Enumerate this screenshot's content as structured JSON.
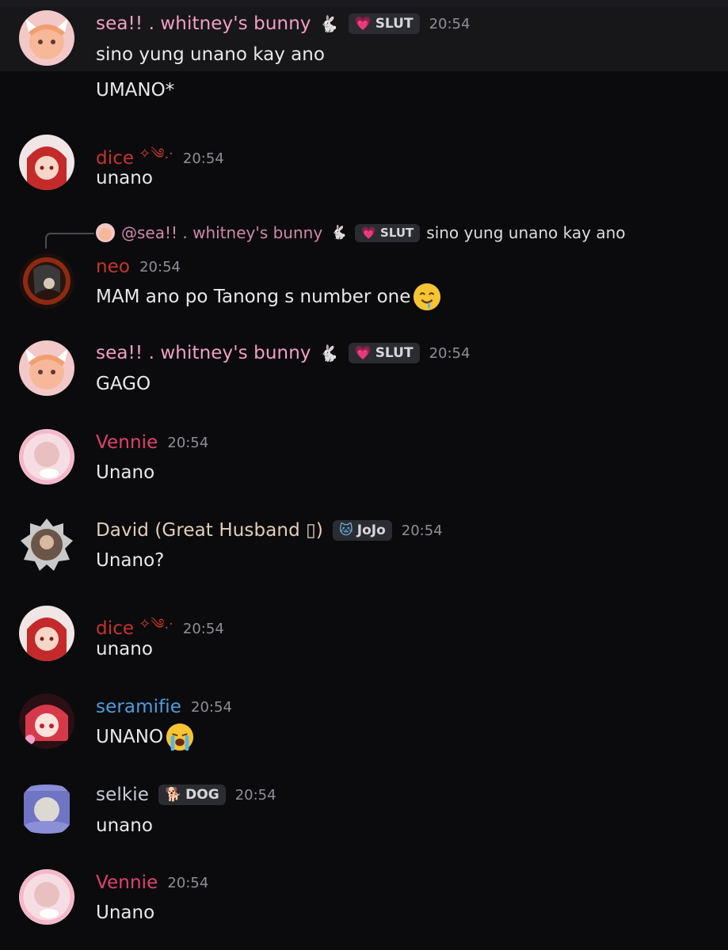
{
  "colors": {
    "background": "#0b0b0d",
    "highlight_row": "#17171a",
    "username_sea": "#f39fc4",
    "username_dice": "#c7342a",
    "username_neo": "#c7342a",
    "username_vennie": "#e0426f",
    "username_david": "#e3cfb9",
    "username_seramifie": "#4a9fe0",
    "username_selkie": "#c7cbd6",
    "timestamp": "#8e8f96"
  },
  "messages": [
    {
      "username": "sea!! . whitney's bunny",
      "username_icon": "rabbit-icon",
      "tag": {
        "icon": "pink-heart-icon",
        "label": "SLUT"
      },
      "time": "20:54",
      "lines": [
        "sino yung unano kay ano",
        "UMANO*"
      ]
    },
    {
      "username": "dice",
      "username_deco": "✧༄.·",
      "time": "20:54",
      "lines": [
        "unano"
      ]
    },
    {
      "reply": {
        "mention": "@sea!! . whitney's bunny",
        "icon": "rabbit-icon",
        "tag": {
          "icon": "pink-heart-icon",
          "label": "SLUT"
        },
        "text": "sino yung unano kay ano"
      },
      "username": "neo",
      "time": "20:54",
      "lines": [
        "MAM ano po Tanong s number one"
      ],
      "emoji": "drooling-face-emoji"
    },
    {
      "username": "sea!! . whitney's bunny",
      "username_icon": "rabbit-icon",
      "tag": {
        "icon": "pink-heart-icon",
        "label": "SLUT"
      },
      "time": "20:54",
      "lines": [
        "GAGO"
      ]
    },
    {
      "username": "Vennie",
      "time": "20:54",
      "lines": [
        "Unano"
      ]
    },
    {
      "username": "David (Great Husband ▯)",
      "tag": {
        "icon": "blue-cat-icon",
        "label": "JoJo"
      },
      "time": "20:54",
      "lines": [
        "Unano?"
      ]
    },
    {
      "username": "dice",
      "username_deco": "✧༄.·",
      "time": "20:54",
      "lines": [
        "unano"
      ]
    },
    {
      "username": "seramifie",
      "time": "20:54",
      "lines": [
        "UNANO"
      ],
      "emoji": "loudly-crying-face-emoji"
    },
    {
      "username": "selkie",
      "tag": {
        "icon": "dog-icon",
        "label": "DOG"
      },
      "time": "20:54",
      "lines": [
        "unano"
      ]
    },
    {
      "username": "Vennie",
      "time": "20:54",
      "lines": [
        "Unano"
      ]
    }
  ]
}
